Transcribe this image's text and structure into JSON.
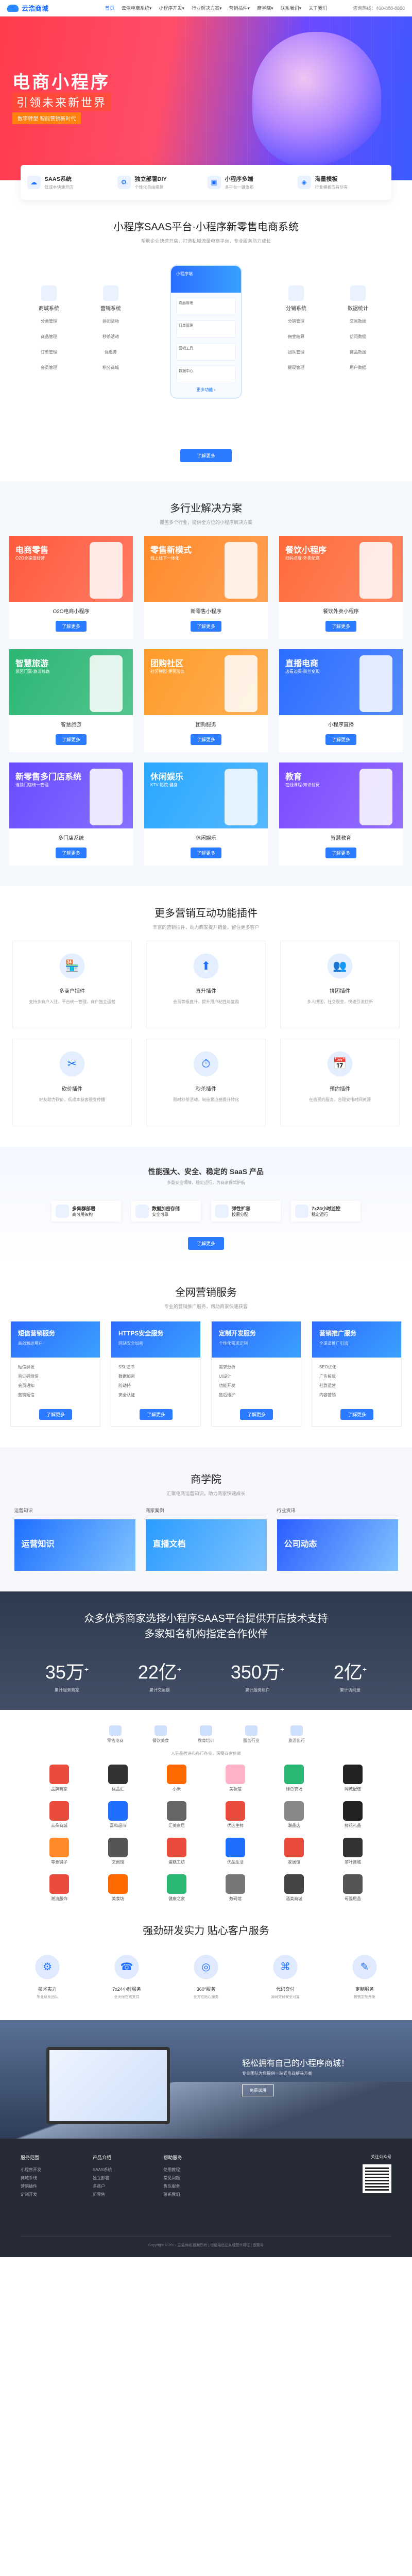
{
  "header": {
    "logo": "云浩商城",
    "nav": [
      "首页",
      "云浩电商系统▾",
      "小程序开发▾",
      "行业解决方案▾",
      "营销插件▾",
      "商学院▾",
      "联系我们▾",
      "关于我们"
    ],
    "tel": "咨询热线：400-888-8888"
  },
  "hero": {
    "title": "电商小程序",
    "subtitle": "引领未来新世界",
    "tag": "数字转型·智能营销新时代"
  },
  "features": [
    {
      "t": "SAAS系统",
      "s": "低成本快速开店",
      "i": "☁"
    },
    {
      "t": "独立部署DIY",
      "s": "个性化自由搭建",
      "i": "⚙"
    },
    {
      "t": "小程序多端",
      "s": "多平台一键发布",
      "i": "▣"
    },
    {
      "t": "海量模板",
      "s": "行业模板应有尽有",
      "i": "◈"
    }
  ],
  "saas": {
    "title": "小程序SAAS平台·小程序新零售电商系统",
    "sub": "帮助企业快速开店，打造私域流量电商平台，专业服务助力成长",
    "left": [
      {
        "t": "商城系统",
        "items": [
          "分类管理",
          "商品管理",
          "订单管理",
          "会员管理"
        ]
      },
      {
        "t": "营销系统",
        "items": [
          "拼团活动",
          "秒杀活动",
          "优惠券",
          "积分商城"
        ]
      }
    ],
    "right": [
      {
        "t": "分销系统",
        "items": [
          "分销管理",
          "佣金结算",
          "团队管理",
          "提现管理"
        ]
      },
      {
        "t": "数据统计",
        "items": [
          "交易数据",
          "访问数据",
          "商品数据",
          "用户数据"
        ]
      }
    ],
    "phone": {
      "head": "小程序端",
      "rows": [
        "商品管理",
        "订单管理",
        "营销工具",
        "数据中心"
      ],
      "foot": "更多功能 ›"
    },
    "button": "了解更多"
  },
  "industry": {
    "title": "多行业解决方案",
    "sub": "覆盖多个行业，提供全方位的小程序解决方案",
    "items": [
      {
        "name": "O2O电商小程序",
        "big": "电商零售",
        "sm": "O2O全渠道经营",
        "c": "#ff5a3c"
      },
      {
        "name": "新零售小程序",
        "big": "零售新模式",
        "sm": "线上线下一体化",
        "c": "#ff8a2a"
      },
      {
        "name": "餐饮外卖小程序",
        "big": "餐饮小程序",
        "sm": "扫码点餐·外卖配送",
        "c": "#ff6a3a"
      },
      {
        "name": "智慧旅游",
        "big": "智慧旅游",
        "sm": "景区门票·旅游线路",
        "c": "#2ab673"
      },
      {
        "name": "团购服务",
        "big": "团购社区",
        "sm": "社区拼团·便民服务",
        "c": "#ff9b2a"
      },
      {
        "name": "小程序直播",
        "big": "直播电商",
        "sm": "边看边买·粉丝变现",
        "c": "#2a6dff"
      },
      {
        "name": "多门店系统",
        "big": "新零售多门店系统",
        "sm": "连锁门店统一管理",
        "c": "#6a4bff"
      },
      {
        "name": "休闲娱乐",
        "big": "休闲娱乐",
        "sm": "KTV·影院·健身",
        "c": "#2aa7ff"
      },
      {
        "name": "智慧教育",
        "big": "教育",
        "sm": "在线课程·知识付费",
        "c": "#7a4bff"
      }
    ],
    "button": "了解更多"
  },
  "plugins": {
    "title": "更多营销互动功能插件",
    "sub": "丰富的营销插件，助力商家提升销量，留住更多客户",
    "items": [
      {
        "t": "多商户插件",
        "d": "支持多商户入驻，平台统一管理，商户独立运营",
        "i": "🏪"
      },
      {
        "t": "直升插件",
        "d": "会员等级直升，提升用户粘性与复购",
        "i": "⬆"
      },
      {
        "t": "拼团插件",
        "d": "多人拼团，社交裂变，快速引流拉新",
        "i": "👥"
      },
      {
        "t": "砍价插件",
        "d": "好友助力砍价，低成本获客裂变传播",
        "i": "✂"
      },
      {
        "t": "秒杀插件",
        "d": "限时秒杀活动，制造紧迫感提升转化",
        "i": "⏱"
      },
      {
        "t": "预约插件",
        "d": "在线预约服务，合理安排时间资源",
        "i": "📅"
      }
    ]
  },
  "performance": {
    "title": "性能强大、安全、稳定的 SaaS 产品",
    "sub": "多重安全保障，稳定运行，为商家保驾护航",
    "items": [
      {
        "t": "多集群部署",
        "d": "高可用架构"
      },
      {
        "t": "数据加密存储",
        "d": "安全可靠"
      },
      {
        "t": "弹性扩容",
        "d": "按需分配"
      },
      {
        "t": "7x24小时监控",
        "d": "稳定运行"
      }
    ],
    "button": "了解更多"
  },
  "marketing": {
    "title": "全网营销服务",
    "sub": "专业的营销推广服务，帮助商家快速获客",
    "items": [
      {
        "t": "短信营销服务",
        "d": "高效触达用户",
        "list": [
          "短信群发",
          "验证码短信",
          "会员通知",
          "营销短信"
        ]
      },
      {
        "t": "HTTPS安全服务",
        "d": "网站安全加密",
        "list": [
          "SSL证书",
          "数据加密",
          "防劫持",
          "安全认证"
        ]
      },
      {
        "t": "定制开发服务",
        "d": "个性化需求定制",
        "list": [
          "需求分析",
          "UI设计",
          "功能开发",
          "售后维护"
        ]
      },
      {
        "t": "营销推广服务",
        "d": "全渠道推广引流",
        "list": [
          "SEO优化",
          "广告投放",
          "社群运营",
          "内容营销"
        ]
      }
    ],
    "button": "了解更多"
  },
  "school": {
    "title": "商学院",
    "sub": "汇聚电商运营知识，助力商家快速成长",
    "items": [
      {
        "l": "运营知识",
        "img": "运营知识",
        "c": "#1e6fff"
      },
      {
        "l": "商家案例",
        "img": "直播文档",
        "c": "#2a9cff"
      },
      {
        "l": "行业资讯",
        "img": "公司动态",
        "c": "#2a5dff"
      }
    ]
  },
  "stats": {
    "title": "众多优秀商家选择小程序SAAS平台提供开店技术支持",
    "title2": "多家知名机构指定合作伙伴",
    "items": [
      {
        "n": "35万",
        "l": "累计服务商家"
      },
      {
        "n": "22亿",
        "l": "累计交易额"
      },
      {
        "n": "350万",
        "l": "累计服务用户"
      },
      {
        "n": "2亿",
        "l": "累计访问量"
      }
    ]
  },
  "brands": {
    "tabs": [
      "零售电商",
      "餐饮美食",
      "教育培训",
      "服务行业",
      "旅游出行"
    ],
    "sub": "入驻品牌遍布各行各业，深受商家信赖",
    "items": [
      {
        "n": "品牌商家",
        "c": "#e94b3c"
      },
      {
        "n": "优品汇",
        "c": "#333"
      },
      {
        "n": "小米",
        "c": "#ff6a00"
      },
      {
        "n": "美妆馆",
        "c": "#ffb3c8"
      },
      {
        "n": "绿色农场",
        "c": "#2ab673"
      },
      {
        "n": "同城配送",
        "c": "#222"
      },
      {
        "n": "云朵商城",
        "c": "#e94b3c"
      },
      {
        "n": "嘉和超市",
        "c": "#1e6fff"
      },
      {
        "n": "汇美家居",
        "c": "#666"
      },
      {
        "n": "优选生鲜",
        "c": "#e94b3c"
      },
      {
        "n": "潮品店",
        "c": "#888"
      },
      {
        "n": "鲜花礼品",
        "c": "#222"
      },
      {
        "n": "零食铺子",
        "c": "#ff8a2a"
      },
      {
        "n": "文创馆",
        "c": "#555"
      },
      {
        "n": "蛋糕工坊",
        "c": "#e94b3c"
      },
      {
        "n": "优品生活",
        "c": "#1e6fff"
      },
      {
        "n": "家居馆",
        "c": "#e94b3c"
      },
      {
        "n": "茶叶商城",
        "c": "#333"
      },
      {
        "n": "潮流服饰",
        "c": "#e94b3c"
      },
      {
        "n": "美食坊",
        "c": "#ff6a00"
      },
      {
        "n": "健康之家",
        "c": "#2ab673"
      },
      {
        "n": "数码馆",
        "c": "#777"
      },
      {
        "n": "酒类商城",
        "c": "#444"
      },
      {
        "n": "母婴用品",
        "c": "#555"
      }
    ]
  },
  "support": {
    "title": "强劲研发实力  贴心客户服务",
    "items": [
      {
        "t": "技术实力",
        "d": "专业研发团队"
      },
      {
        "t": "7x24小时服务",
        "d": "全天候在线支持"
      },
      {
        "t": "360°服务",
        "d": "全方位贴心服务"
      },
      {
        "t": "代码交付",
        "d": "源码交付安全可靠"
      },
      {
        "t": "定制服务",
        "d": "按需定制开发"
      }
    ]
  },
  "banner": {
    "title": "轻松拥有自己的小程序商城！",
    "sub": "专业团队为您提供一站式电商解决方案",
    "button": "免费试用"
  },
  "footer": {
    "cols": [
      {
        "h": "服务范围",
        "items": [
          "小程序开发",
          "商城系统",
          "营销插件",
          "定制开发"
        ]
      },
      {
        "h": "产品介绍",
        "items": [
          "SAAS系统",
          "独立部署",
          "多商户",
          "新零售"
        ]
      },
      {
        "h": "帮助服务",
        "items": [
          "使用教程",
          "常见问题",
          "售后服务",
          "联系我们"
        ]
      }
    ],
    "qr": "关注公众号",
    "copy": "Copyright © 2023 云浩商城 版权所有 | 增值电信业务经营许可证 | 备案号"
  }
}
